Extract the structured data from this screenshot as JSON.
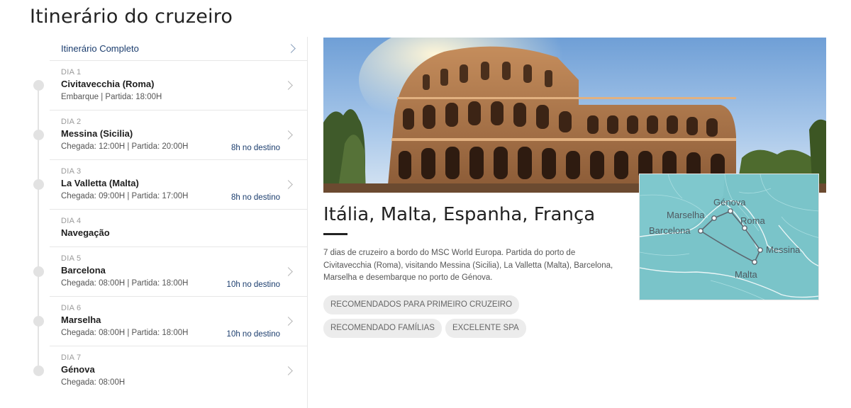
{
  "page_title": "Itinerário do cruzeiro",
  "itinerary": {
    "full_link_label": "Itinerário Completo",
    "days": [
      {
        "day": "DIA 1",
        "port": "Civitavecchia (Roma)",
        "times": "Embarque | Partida: 18:00H",
        "dest": ""
      },
      {
        "day": "DIA 2",
        "port": "Messina (Sicilia)",
        "times": "Chegada: 12:00H | Partida: 20:00H",
        "dest": "8h no destino"
      },
      {
        "day": "DIA 3",
        "port": "La Valletta (Malta)",
        "times": "Chegada: 09:00H | Partida: 17:00H",
        "dest": "8h no destino"
      },
      {
        "day": "DIA 4",
        "port": "Navegação",
        "times": "",
        "dest": ""
      },
      {
        "day": "DIA 5",
        "port": "Barcelona",
        "times": "Chegada: 08:00H | Partida: 18:00H",
        "dest": "10h no destino"
      },
      {
        "day": "DIA 6",
        "port": "Marselha",
        "times": "Chegada: 08:00H | Partida: 18:00H",
        "dest": "10h no destino"
      },
      {
        "day": "DIA 7",
        "port": "Génova",
        "times": "Chegada: 08:00H",
        "dest": ""
      }
    ]
  },
  "destination": {
    "title": "Itália, Malta, Espanha, França",
    "description": "7 dias de cruzeiro a bordo do MSC World Europa. Partida do porto de Civitavecchia (Roma), visitando Messina (Sicilia), La Valletta (Malta), Barcelona, Marselha e desembarque no porto de Génova.",
    "tags": [
      "RECOMENDADOS PARA PRIMEIRO CRUZEIRO",
      "RECOMENDADO FAMÍLIAS",
      "EXCELENTE SPA"
    ]
  },
  "map": {
    "labels": {
      "genova": "Génova",
      "marselha": "Marselha",
      "roma": "Roma",
      "barcelona": "Barcelona",
      "messina": "Messina",
      "malta": "Malta"
    },
    "colors": {
      "sea": "#7ac4c9",
      "land": "#ffffff",
      "route": "#5c6770"
    }
  },
  "colors": {
    "accent": "#1b3d6e",
    "tag_bg": "#ececec",
    "dot": "#e2e2e2"
  }
}
